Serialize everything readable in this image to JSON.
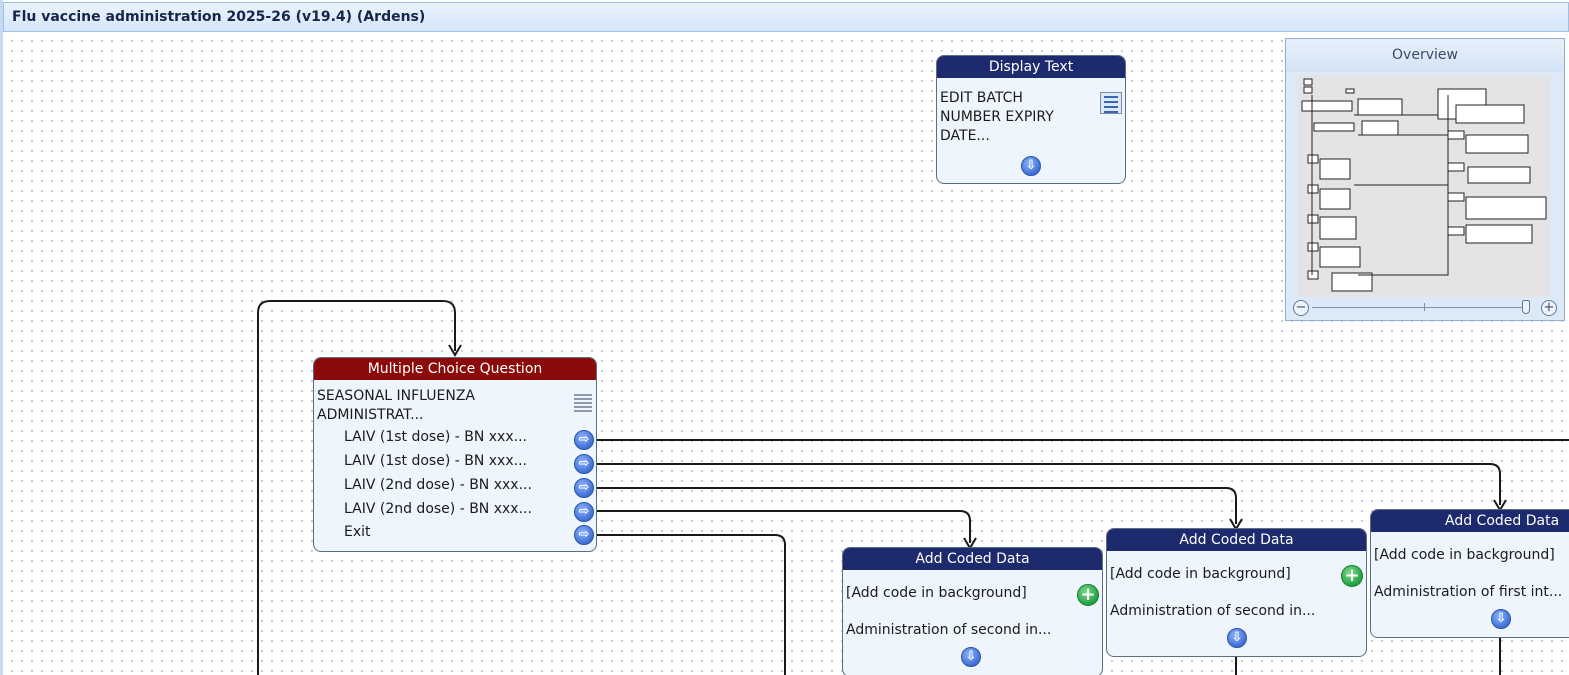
{
  "window": {
    "title": "Flu vaccine administration 2025-26 (v19.4) (Ardens)"
  },
  "overview": {
    "title": "Overview",
    "zoom_out_icon": "minus-circle-icon",
    "zoom_in_icon": "plus-circle-icon"
  },
  "nodes": {
    "display_text": {
      "header": "Display Text",
      "lines": [
        "EDIT  BATCH",
        "NUMBER EXPIRY",
        "DATE..."
      ],
      "icon": "text-doc-icon"
    },
    "mcq": {
      "header": "Multiple Choice Question",
      "lines": [
        "SEASONAL INFLUENZA",
        "ADMINISTRAT..."
      ],
      "options": [
        "LAIV (1st dose) - BN xxx...",
        "LAIV (1st dose) - BN xxx...",
        "LAIV (2nd dose) - BN xxx...",
        "LAIV (2nd dose) - BN xxx...",
        "Exit"
      ],
      "icon": "list-icon"
    },
    "coded_1": {
      "header": "Add Coded Data",
      "line1": "[Add code in background]",
      "line2": "Administration of second in..."
    },
    "coded_2": {
      "header": "Add Coded Data",
      "line1": "[Add code in background]",
      "line2": "Administration of second in..."
    },
    "coded_3": {
      "header": "Add Coded Data",
      "line1": "[Add code in background]",
      "line2": "Administration of first int..."
    }
  },
  "colors": {
    "header_blue": "#1d2a6e",
    "header_red": "#8b0a0a",
    "node_bg": "#eef5fc",
    "connector": "#1a1a1a"
  }
}
